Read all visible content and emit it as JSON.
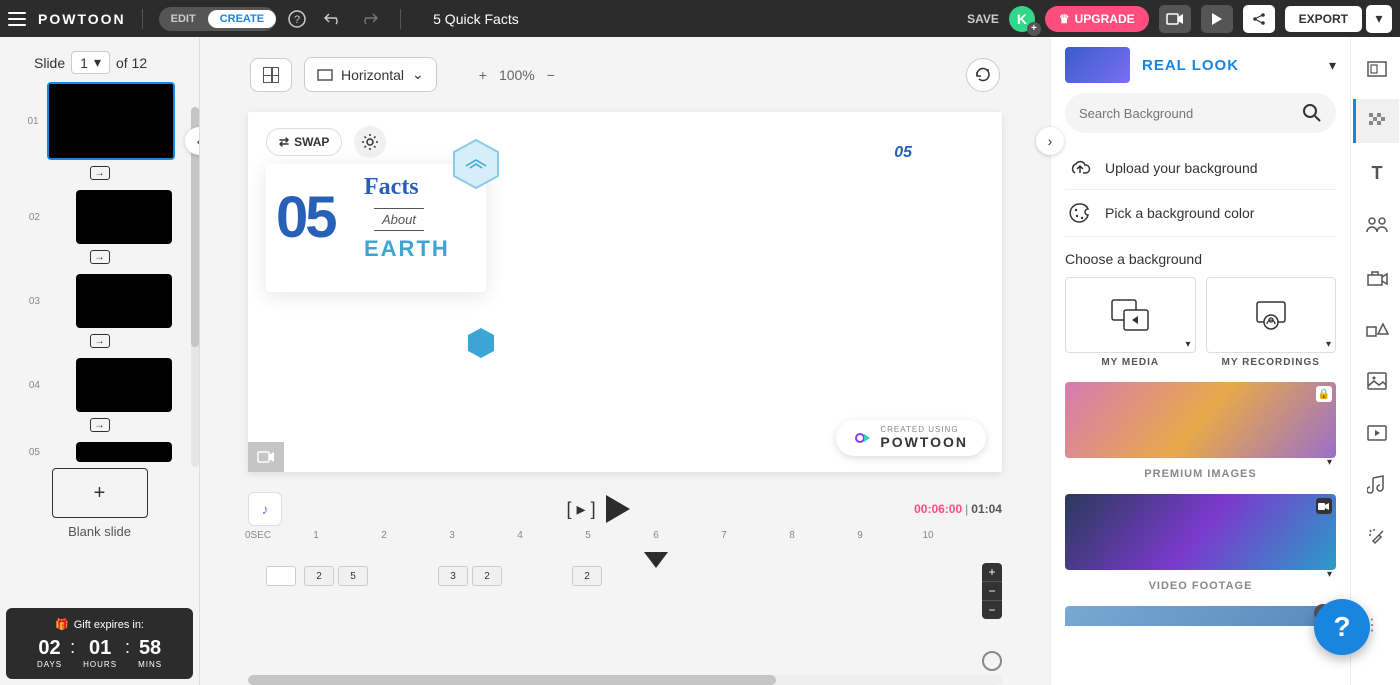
{
  "topbar": {
    "logo": "POWTOON",
    "mode_edit": "EDIT",
    "mode_create": "CREATE",
    "project_title": "5 Quick Facts",
    "save": "SAVE",
    "avatar_initial": "K",
    "upgrade": "UPGRADE",
    "export": "EXPORT"
  },
  "slide_header": {
    "label": "Slide",
    "current": "1",
    "of": "of 12"
  },
  "slides": [
    {
      "num": "01",
      "active": true
    },
    {
      "num": "02"
    },
    {
      "num": "03"
    },
    {
      "num": "04"
    },
    {
      "num": "05"
    }
  ],
  "blank_slide_label": "Blank slide",
  "gift": {
    "title": "Gift expires in:",
    "days_num": "02",
    "days_label": "DAYS",
    "hours_num": "01",
    "hours_label": "HOURS",
    "mins_num": "58",
    "mins_label": "MINS"
  },
  "toolbar": {
    "orientation": "Horizontal",
    "zoom": "100%",
    "swap": "SWAP"
  },
  "canvas": {
    "big_num": "05",
    "facts": "Facts",
    "about": "About",
    "earth": "EARTH",
    "badge_num": "05",
    "created_using": "CREATED USING",
    "powtoon": "POWTOON"
  },
  "timeline": {
    "current_time": "00:06:00",
    "total_time": "01:04",
    "sec_label": "0SEC",
    "ticks": [
      "1",
      "2",
      "3",
      "4",
      "5",
      "6",
      "7",
      "8",
      "9",
      "10"
    ],
    "clips": [
      "2",
      "5",
      "3",
      "2",
      "2"
    ]
  },
  "right": {
    "look_title": "REAL LOOK",
    "search_placeholder": "Search Background",
    "upload_bg": "Upload your background",
    "pick_color": "Pick a background color",
    "choose_bg": "Choose a background",
    "my_media": "MY MEDIA",
    "my_recordings": "MY RECORDINGS",
    "premium_images": "PREMIUM IMAGES",
    "video_footage": "VIDEO FOOTAGE"
  }
}
